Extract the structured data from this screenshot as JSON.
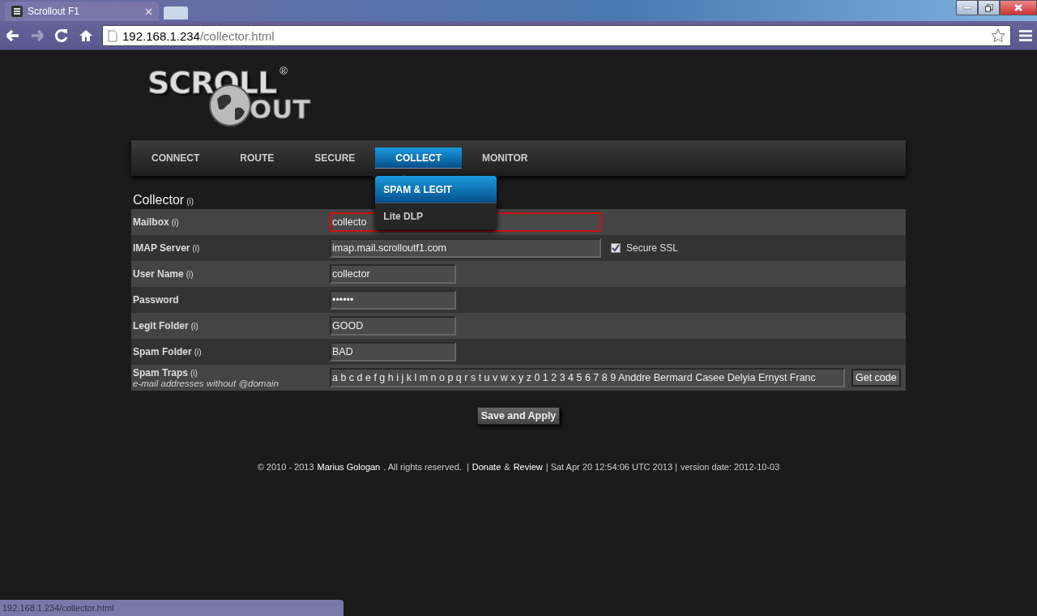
{
  "browser": {
    "tab_title": "Scrollout F1",
    "address_host": "192.168.1.234",
    "address_path": "/collector.html",
    "status_url": "192.168.1.234/collector.html"
  },
  "logo": {
    "word_1": "SCROLL",
    "word_2": "OUT",
    "mark": "®"
  },
  "nav": [
    {
      "label": "CONNECT",
      "selected": false
    },
    {
      "label": "ROUTE",
      "selected": false
    },
    {
      "label": "SECURE",
      "selected": false
    },
    {
      "label": "COLLECT",
      "selected": true,
      "submenu": [
        {
          "label": "SPAM & LEGIT",
          "selected": true
        },
        {
          "label": "Lite DLP",
          "selected": false
        }
      ]
    },
    {
      "label": "MONITOR",
      "selected": false
    }
  ],
  "section": {
    "title": "Collector",
    "info": "(i)"
  },
  "rows": [
    {
      "label": "Mailbox",
      "info": "(i)",
      "value": "collecto",
      "invalid": true
    },
    {
      "label": "IMAP Server",
      "info": "(i)",
      "value": "imap.mail.scrolloutf1.com",
      "invalid": false,
      "checkbox": {
        "label": "Secure SSL",
        "checked": true
      }
    },
    {
      "label": "User Name",
      "info": "(i)",
      "value": "collector",
      "invalid": false
    },
    {
      "label": "Password",
      "value": "••••••",
      "invalid": false
    },
    {
      "label": "Legit Folder",
      "info": "(i)",
      "value": "GOOD",
      "invalid": false
    },
    {
      "label": "Spam Folder",
      "info": "(i)",
      "value": "BAD",
      "invalid": false
    },
    {
      "label": "Spam Traps",
      "info": "(i)",
      "hint": "e-mail addresses without @domain",
      "value": "a b c d e f g h i j k l m n o p q r s t u v w x y z 0 1 2 3 4 5 6 7 8 9 Anddre Bermard Casee Delyia Ernyst Franc",
      "invalid": false,
      "button": "Get code"
    }
  ],
  "save_button": "Save and Apply",
  "footer": {
    "copyright": "© 2010 - 2013",
    "author": "Marius Gologan",
    "rights": ". All rights reserved.  |",
    "donate": "Donate",
    "amp": "&",
    "review": "Review",
    "date": "| Sat Apr 20 12:54:06 UTC 2013 |",
    "version": "version date: 2012-10-03"
  }
}
